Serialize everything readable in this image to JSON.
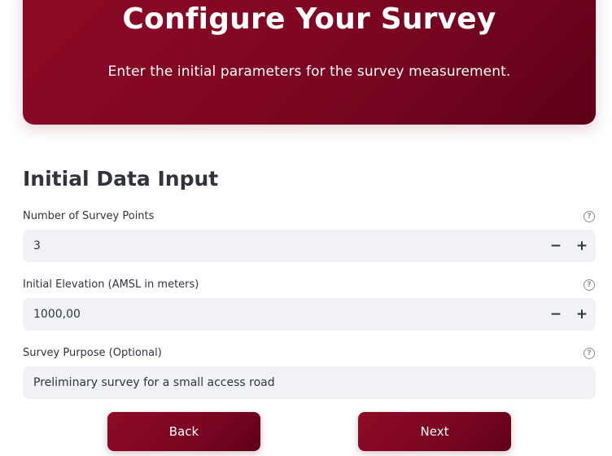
{
  "hero": {
    "title": "Configure Your Survey",
    "subtitle": "Enter the initial parameters for the survey measurement."
  },
  "section": {
    "title": "Initial Data Input"
  },
  "fields": [
    {
      "label": "Number of Survey Points",
      "value": "3",
      "help_icon": "question-circle-icon",
      "stepper": true
    },
    {
      "label": "Initial Elevation (AMSL in meters)",
      "value": "1000,00",
      "help_icon": "question-circle-icon",
      "stepper": true
    },
    {
      "label": "Survey Purpose (Optional)",
      "value": "Preliminary survey for a small access road",
      "help_icon": "question-circle-icon",
      "stepper": false
    }
  ],
  "stepper": {
    "minus": "−",
    "plus": "+"
  },
  "help_glyph": "?",
  "buttons": {
    "back": "Back",
    "next": "Next"
  },
  "colors": {
    "accent": "#7c0622",
    "accent_dark": "#5e0018",
    "input_bg": "#f0f2f6",
    "text": "#31333f"
  }
}
